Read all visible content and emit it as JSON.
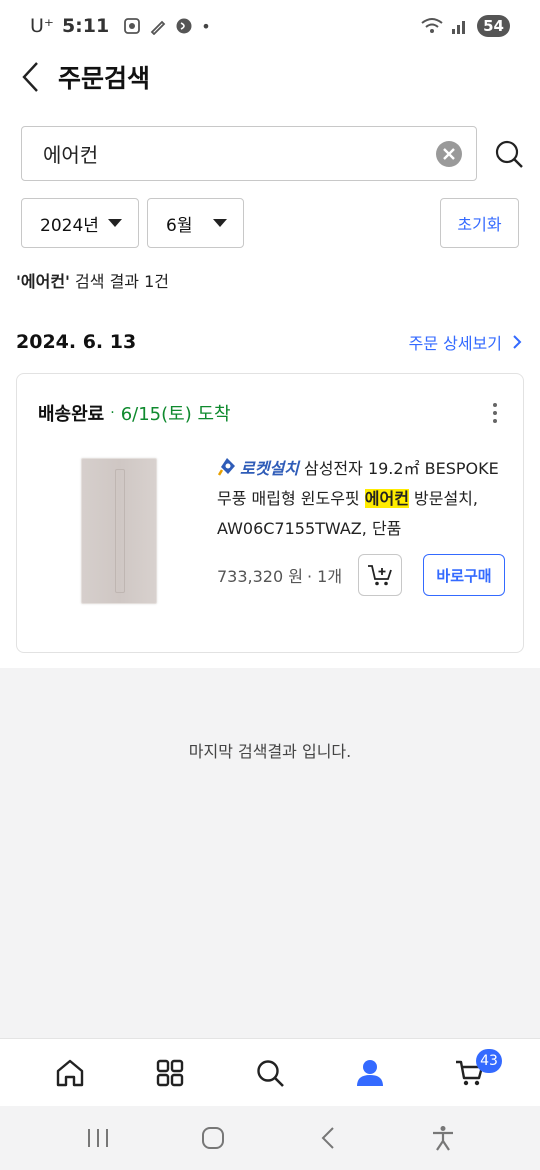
{
  "status_bar": {
    "carrier": "U⁺",
    "time": "5:11",
    "battery": "54"
  },
  "header": {
    "title": "주문검색"
  },
  "search": {
    "query": "에어컨"
  },
  "filters": {
    "year": "2024년",
    "month": "6월",
    "reset_label": "초기화"
  },
  "result_summary": {
    "keyword": "'에어컨'",
    "text": " 검색 결과 1건"
  },
  "order": {
    "date": "2024. 6. 13",
    "detail_link": "주문 상세보기",
    "status": "배송완료",
    "arrival": "6/15(토) 도착",
    "product": {
      "badge": "로켓설치",
      "name_before": " 삼성전자 19.2㎡ BESPOKE 무풍 매립형 윈도우핏 ",
      "name_highlight": "에어컨",
      "name_after": " 방문설치, AW06C7155TWAZ, 단품",
      "price": "733,320 원",
      "quantity": "· 1개",
      "buy_label": "바로구매"
    }
  },
  "end_message": "마지막 검색결과 입니다.",
  "bottom_nav": {
    "cart_badge": "43"
  },
  "colors": {
    "accent": "#346aff",
    "delivered_green": "#0f8a2e",
    "highlight": "#ffec00"
  }
}
